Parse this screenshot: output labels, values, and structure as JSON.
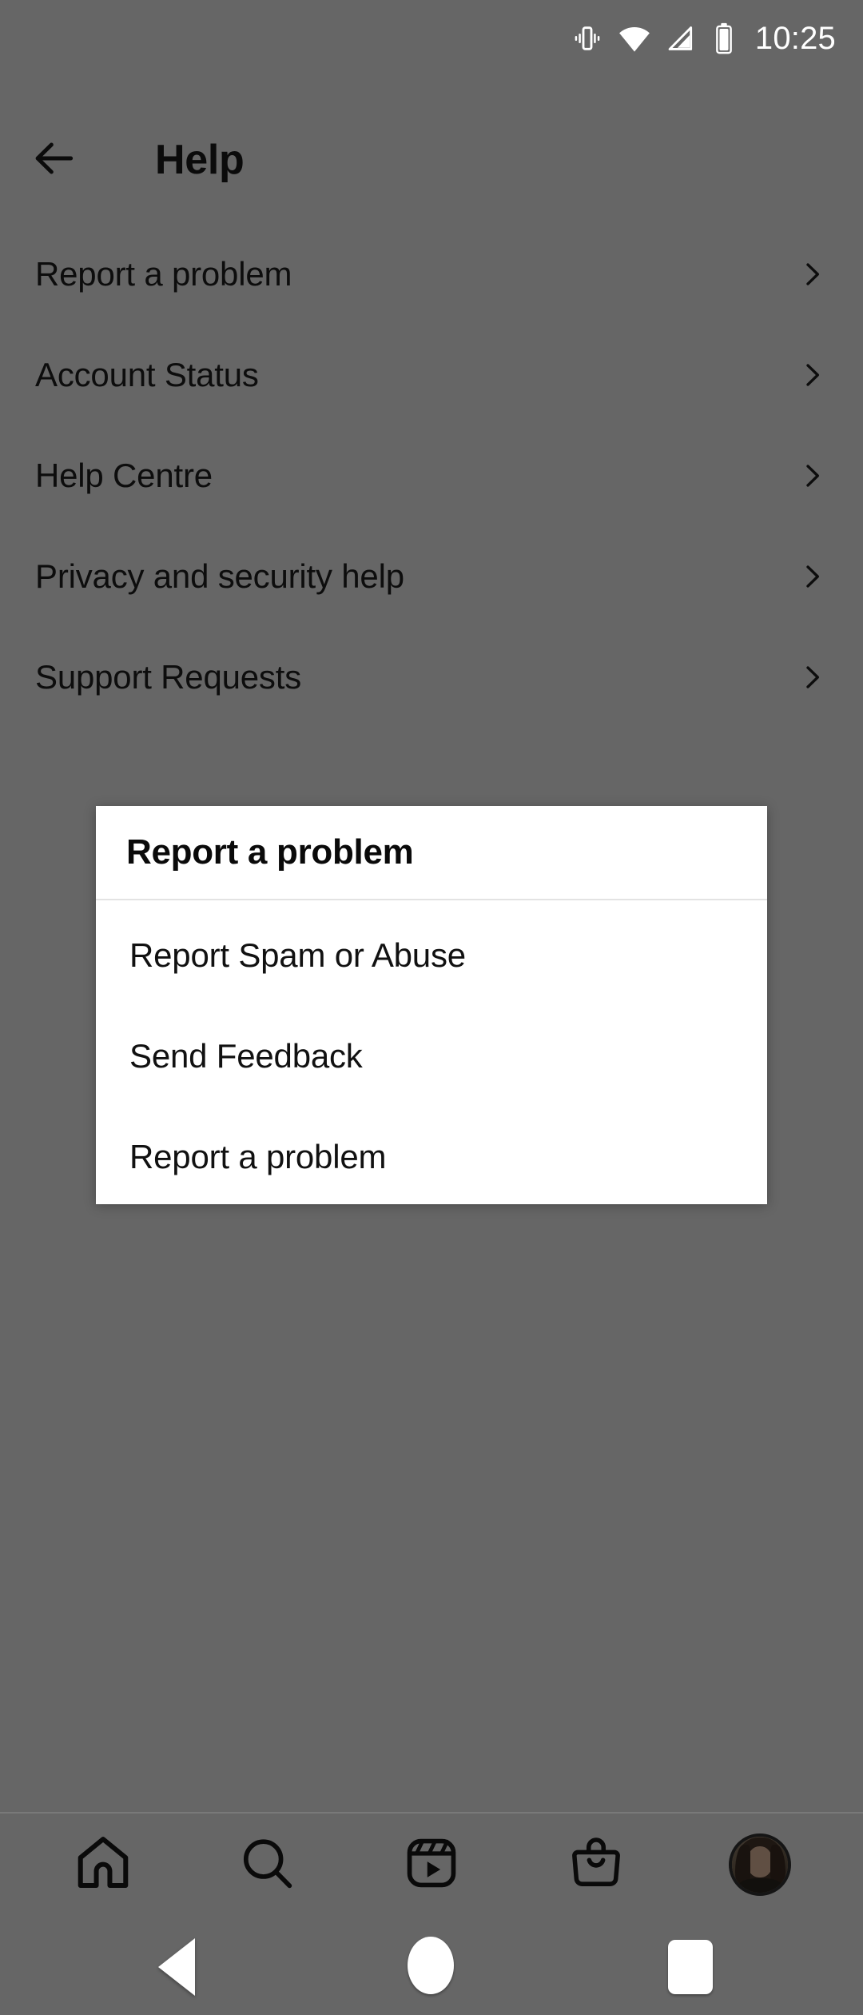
{
  "status_bar": {
    "icons": [
      "vibrate-icon",
      "wifi-icon",
      "cellular-signal-icon",
      "battery-icon"
    ],
    "clock": "10:25"
  },
  "app_bar": {
    "back_icon": "back-arrow-icon",
    "title": "Help"
  },
  "help_list": {
    "items": [
      {
        "label": "Report a problem",
        "chevron": "chevron-right-icon"
      },
      {
        "label": "Account Status",
        "chevron": "chevron-right-icon"
      },
      {
        "label": "Help Centre",
        "chevron": "chevron-right-icon"
      },
      {
        "label": "Privacy and security help",
        "chevron": "chevron-right-icon"
      },
      {
        "label": "Support Requests",
        "chevron": "chevron-right-icon"
      }
    ]
  },
  "dialog": {
    "title": "Report a problem",
    "options": [
      {
        "label": "Report Spam or Abuse"
      },
      {
        "label": "Send Feedback"
      },
      {
        "label": "Report a problem"
      }
    ]
  },
  "bottom_nav": {
    "items": [
      {
        "name": "home-icon"
      },
      {
        "name": "search-icon"
      },
      {
        "name": "reels-icon"
      },
      {
        "name": "shop-icon"
      },
      {
        "name": "profile-avatar"
      }
    ]
  },
  "system_nav": {
    "back": "system-back-icon",
    "home": "system-home-icon",
    "recents": "system-recents-icon"
  },
  "colors": {
    "scrim_background": "#666666",
    "dialog_background": "#ffffff",
    "text_primary": "#0d0d0d",
    "status_text": "#ffffff",
    "divider": "#e3e3e3"
  }
}
